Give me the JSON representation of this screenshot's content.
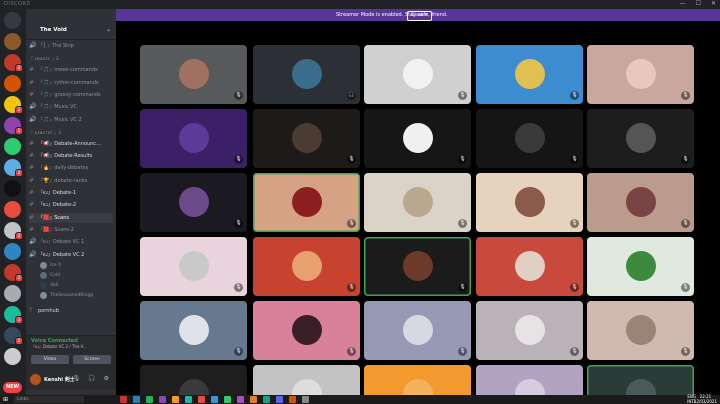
{
  "window": {
    "brand": "DISCORD",
    "controls": [
      "—",
      "☐",
      "✕"
    ]
  },
  "servers": [
    {
      "icon": "discord-logo-icon",
      "color": "#36393f",
      "badge": ""
    },
    {
      "icon": "server-icon",
      "color": "#8b5a2b",
      "badge": ""
    },
    {
      "icon": "server-icon",
      "color": "#c0392b",
      "badge": "2"
    },
    {
      "icon": "server-icon",
      "color": "#d35400",
      "badge": ""
    },
    {
      "icon": "server-icon",
      "color": "#f1c40f",
      "badge": "2"
    },
    {
      "icon": "server-icon",
      "color": "#8e44ad",
      "badge": "1"
    },
    {
      "icon": "server-icon",
      "color": "#2ecc71",
      "badge": ""
    },
    {
      "icon": "server-icon",
      "color": "#5dade2",
      "badge": "2"
    },
    {
      "icon": "server-icon",
      "color": "#111111",
      "badge": ""
    },
    {
      "icon": "server-icon",
      "color": "#e74c3c",
      "badge": ""
    },
    {
      "icon": "server-icon",
      "color": "#bdc3c7",
      "badge": "2"
    },
    {
      "icon": "server-icon",
      "color": "#2e86c1",
      "badge": ""
    },
    {
      "icon": "server-icon",
      "color": "#c0392b",
      "badge": "2"
    },
    {
      "icon": "server-icon",
      "color": "#a6acaf",
      "badge": ""
    },
    {
      "icon": "server-icon",
      "color": "#1abc9c",
      "badge": "3"
    },
    {
      "icon": "server-icon",
      "color": "#34495e",
      "badge": "2"
    },
    {
      "icon": "server-icon",
      "color": "#cccccc",
      "badge": ""
    }
  ],
  "new_label": "NEW",
  "guild": {
    "name": "The Void",
    "chevron": "⌄"
  },
  "channels": [
    {
      "glyph": "🔊",
      "label": "『〚 』The Ship",
      "kind": "voice",
      "style": "normal"
    },
    {
      "category": "『 ɪᴍᴀɢᴇs 』3"
    },
    {
      "glyph": "#",
      "label": "『🎵』meeé-commands",
      "kind": "text",
      "style": "normal"
    },
    {
      "glyph": "#",
      "label": "『🎵』rythm-commands",
      "kind": "text",
      "style": "normal"
    },
    {
      "glyph": "#",
      "label": "『🎵』groovy-commands",
      "kind": "text",
      "style": "normal"
    },
    {
      "glyph": "🔊",
      "label": "『🎵』Music VC",
      "kind": "voice",
      "style": "normal"
    },
    {
      "glyph": "🔊",
      "label": "『🎵』Music VC 2",
      "kind": "voice",
      "style": "normal"
    },
    {
      "category": "『 ᴅᴇʙᴀᴛᴇs 』3"
    },
    {
      "glyph": "#",
      "label": "『📢』Debate-Announc...",
      "kind": "text",
      "style": "bright"
    },
    {
      "glyph": "#",
      "label": "『📢』Debate-Results",
      "kind": "text",
      "style": "bright"
    },
    {
      "glyph": "#",
      "label": "『🔥』daily-debates",
      "kind": "text",
      "style": "normal"
    },
    {
      "glyph": "#",
      "label": "『🏆』debate-ranks",
      "kind": "text",
      "style": "normal"
    },
    {
      "glyph": "#",
      "label": "『ᴋᴊ』Debate-1",
      "kind": "text",
      "style": "bright"
    },
    {
      "glyph": "#",
      "label": "『ᴋᴊ』Debate-2",
      "kind": "text",
      "style": "bright"
    },
    {
      "glyph": "#",
      "label": "『🟥』Scans",
      "kind": "text",
      "style": "active"
    },
    {
      "glyph": "#",
      "label": "『🟥』Scans-2",
      "kind": "text",
      "style": "normal"
    },
    {
      "glyph": "🔊",
      "label": "『ᴋᴊ』Debate VC 1",
      "kind": "voice",
      "style": "normal"
    },
    {
      "glyph": "🔊",
      "label": "『ᴋᴊ』Debate VC 2",
      "kind": "voice",
      "style": "bright"
    }
  ],
  "vc_users": [
    {
      "name": "Ice X",
      "color": "#7f8c8d"
    },
    {
      "name": "Cold",
      "color": "#5d6d7e"
    },
    {
      "name": "dell",
      "color": "#2c3e50"
    },
    {
      "name": "TheSeasonedKingg",
      "color": "#839192"
    }
  ],
  "extra_channel": {
    "glyph": "?",
    "label": "pornhub"
  },
  "voice": {
    "status": "Voice Connected",
    "location": "『ᴋᴊ』Debate VC 2 / The V...",
    "video": "Video",
    "screen": "Screen"
  },
  "user": {
    "name": "Kenshi 剣士",
    "icons": "🎙 🎧 ⚙"
  },
  "banner": {
    "text": "Streamer Mode is enabled. Stay safe, friend.",
    "button": "Disable"
  },
  "tiles": [
    {
      "bg": "#58595b",
      "av": "#a07060",
      "icon": "mute",
      "speaking": false
    },
    {
      "bg": "#2c3036",
      "av": "#3a6d8c",
      "icon": "deafen",
      "speaking": false
    },
    {
      "bg": "#d0d0d0",
      "av": "#f2f2f2",
      "icon": "mute",
      "speaking": false
    },
    {
      "bg": "#3d8ccf",
      "av": "#e0c050",
      "icon": "mute",
      "speaking": false
    },
    {
      "bg": "#c9a79c",
      "av": "#e8c8bc",
      "icon": "mute",
      "speaking": false
    },
    {
      "bg": "#3b2068",
      "av": "#5b3b98",
      "icon": "mute",
      "speaking": false
    },
    {
      "bg": "#1d1a1a",
      "av": "#4a3b33",
      "icon": "mute",
      "speaking": false
    },
    {
      "bg": "#161616",
      "av": "#f0f0f0",
      "icon": "mute",
      "speaking": false
    },
    {
      "bg": "#151515",
      "av": "#3a3a3a",
      "icon": "mute",
      "speaking": false
    },
    {
      "bg": "#1d1d1d",
      "av": "#555555",
      "icon": "mute",
      "speaking": false
    },
    {
      "bg": "#1a1a20",
      "av": "#6c4a8c",
      "icon": "mute",
      "speaking": false
    },
    {
      "bg": "#d5a283",
      "av": "#8b1e1e",
      "icon": "mute",
      "speaking": true
    },
    {
      "bg": "#dcd3c8",
      "av": "#b8a890",
      "icon": "mute",
      "speaking": false
    },
    {
      "bg": "#e5d3bd",
      "av": "#8a5a4a",
      "icon": "mute",
      "speaking": false
    },
    {
      "bg": "#bb9c8c",
      "av": "#7a4444",
      "icon": "mute",
      "speaking": false
    },
    {
      "bg": "#e9d3dc",
      "av": "#c9c9c9",
      "icon": "mute",
      "speaking": false
    },
    {
      "bg": "#c7432f",
      "av": "#e8a070",
      "icon": "mute",
      "speaking": false
    },
    {
      "bg": "#1b1b1b",
      "av": "#6b3a2a",
      "icon": "mute",
      "speaking": true
    },
    {
      "bg": "#c9493c",
      "av": "#e2cfc4",
      "icon": "mute",
      "speaking": false
    },
    {
      "bg": "#dfe9df",
      "av": "#3c8a3c",
      "icon": "mute",
      "speaking": false
    },
    {
      "bg": "#67798f",
      "av": "#dfe2e8",
      "icon": "mute",
      "speaking": false
    },
    {
      "bg": "#d9809a",
      "av": "#3a1e28",
      "icon": "mute",
      "speaking": false
    },
    {
      "bg": "#9798b3",
      "av": "#d8d8e2",
      "icon": "mute",
      "speaking": false
    },
    {
      "bg": "#b9b2b8",
      "av": "#e7e2e4",
      "icon": "mute",
      "speaking": false
    },
    {
      "bg": "#d0bab0",
      "av": "#9a8478",
      "icon": "mute",
      "speaking": false
    },
    {
      "bg": "#1e1e1e",
      "av": "#3a3a3a",
      "icon": "none",
      "speaking": false
    },
    {
      "bg": "#c3c3c3",
      "av": "#dddddd",
      "icon": "none",
      "speaking": false
    },
    {
      "bg": "#f29a2d",
      "av": "#f2b25d",
      "icon": "none",
      "speaking": false
    },
    {
      "bg": "#b1a3c2",
      "av": "#d6cce0",
      "icon": "none",
      "speaking": false
    },
    {
      "bg": "#2a3b38",
      "av": "#4a5a58",
      "icon": "none",
      "speaking": true
    }
  ],
  "taskbar": {
    "search": "Links",
    "apps": [
      "#c0392b",
      "#2980b9",
      "#27ae60",
      "#8e44ad",
      "#f39c12",
      "#1abc9c",
      "#e74c3c",
      "#3498db",
      "#2ecc71",
      "#9b59b6",
      "#e67e22",
      "#16a085",
      "#5865f2",
      "#d35400",
      "#7f8c8d"
    ],
    "tray": [
      "ENG",
      "INTL"
    ],
    "time": "22:21",
    "date": "12/03/2021"
  }
}
